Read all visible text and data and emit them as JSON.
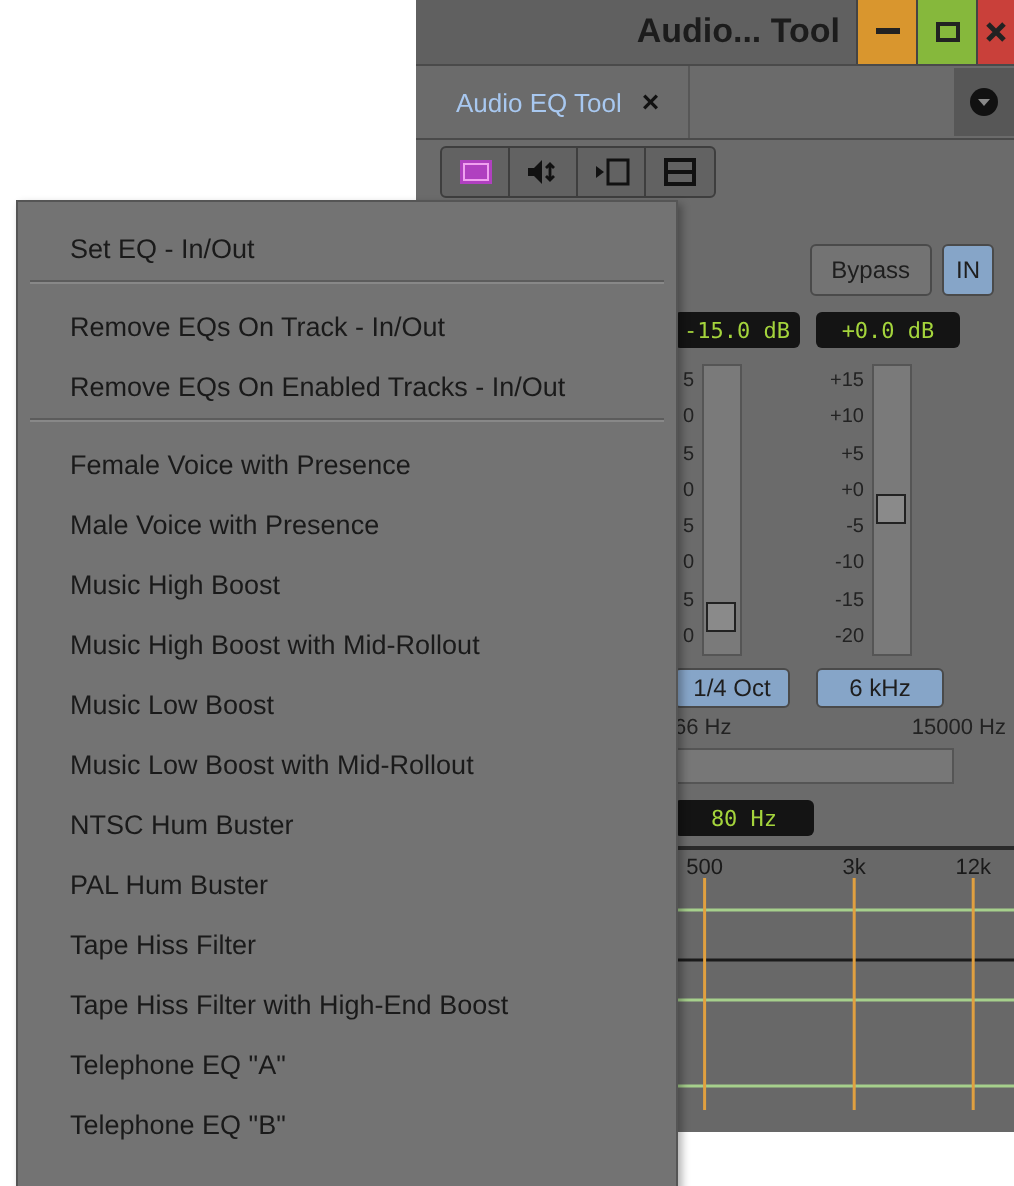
{
  "window": {
    "title": "Audio... Tool"
  },
  "tabs": [
    {
      "label": "Audio EQ Tool",
      "close": "×",
      "selected": true
    }
  ],
  "panel": {
    "bypass": {
      "label": "Bypass",
      "selected": false
    },
    "in": {
      "label": "IN",
      "selected": true
    },
    "bands": [
      {
        "display": "-15.0 dB",
        "scale": [
          "5",
          "0",
          "5",
          "0",
          "5",
          "0",
          "5",
          "0"
        ],
        "level": 0.125,
        "button": "1/4 Oct"
      },
      {
        "display": "+0.0 dB",
        "scale": [
          "+15",
          "+10",
          "+5",
          "+0",
          "-5",
          "-10",
          "-15",
          "-20"
        ],
        "level": 0.5,
        "button": "6 kHz"
      }
    ],
    "range": {
      "min_label": "66 Hz",
      "max_label": "15000 Hz"
    },
    "frequency_display": "80 Hz",
    "graph": {
      "labels": [
        "500",
        "3k",
        "12k"
      ]
    }
  },
  "menu": {
    "items": [
      {
        "kind": "item",
        "label": "Set EQ - In/Out"
      },
      {
        "kind": "separator"
      },
      {
        "kind": "item",
        "label": "Remove EQs On Track - In/Out"
      },
      {
        "kind": "item",
        "label": "Remove EQs On Enabled Tracks - In/Out"
      },
      {
        "kind": "separator"
      },
      {
        "kind": "item",
        "label": "Female Voice with Presence"
      },
      {
        "kind": "item",
        "label": "Male Voice with Presence"
      },
      {
        "kind": "item",
        "label": "Music High Boost"
      },
      {
        "kind": "item",
        "label": "Music High Boost with Mid-Rollout"
      },
      {
        "kind": "item",
        "label": "Music Low Boost"
      },
      {
        "kind": "item",
        "label": "Music Low Boost with Mid-Rollout"
      },
      {
        "kind": "item",
        "label": "NTSC Hum Buster"
      },
      {
        "kind": "item",
        "label": "PAL Hum Buster"
      },
      {
        "kind": "item",
        "label": "Tape Hiss Filter"
      },
      {
        "kind": "item",
        "label": "Tape Hiss Filter with High-End Boost"
      },
      {
        "kind": "item",
        "label": "Telephone EQ \"A\""
      },
      {
        "kind": "item",
        "label": "Telephone EQ \"B\""
      }
    ]
  }
}
